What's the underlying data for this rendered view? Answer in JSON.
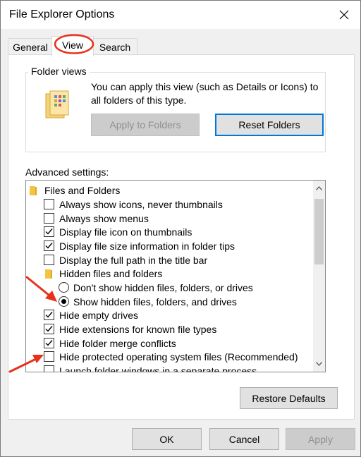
{
  "window": {
    "title": "File Explorer Options"
  },
  "tabs": [
    {
      "label": "General"
    },
    {
      "label": "View"
    },
    {
      "label": "Search"
    }
  ],
  "folder_views": {
    "group_label": "Folder views",
    "description": "You can apply this view (such as Details or Icons) to all folders of this type.",
    "apply_button": "Apply to Folders",
    "reset_button": "Reset Folders"
  },
  "advanced": {
    "label": "Advanced settings:",
    "items": [
      {
        "text": "Files and Folders",
        "kind": "folder"
      },
      {
        "text": "Always show icons, never thumbnails",
        "kind": "checkbox",
        "checked": false
      },
      {
        "text": "Always show menus",
        "kind": "checkbox",
        "checked": false
      },
      {
        "text": "Display file icon on thumbnails",
        "kind": "checkbox",
        "checked": true
      },
      {
        "text": "Display file size information in folder tips",
        "kind": "checkbox",
        "checked": true
      },
      {
        "text": "Display the full path in the title bar",
        "kind": "checkbox",
        "checked": false
      },
      {
        "text": "Hidden files and folders",
        "kind": "folder"
      },
      {
        "text": "Don't show hidden files, folders, or drives",
        "kind": "radio",
        "checked": false
      },
      {
        "text": "Show hidden files, folders, and drives",
        "kind": "radio",
        "checked": true
      },
      {
        "text": "Hide empty drives",
        "kind": "checkbox",
        "checked": true
      },
      {
        "text": "Hide extensions for known file types",
        "kind": "checkbox",
        "checked": true
      },
      {
        "text": "Hide folder merge conflicts",
        "kind": "checkbox",
        "checked": true
      },
      {
        "text": "Hide protected operating system files (Recommended)",
        "kind": "checkbox",
        "checked": false
      },
      {
        "text": "Launch folder windows in a separate process",
        "kind": "checkbox",
        "checked": false
      }
    ]
  },
  "restore_defaults": "Restore Defaults",
  "footer": {
    "ok": "OK",
    "cancel": "Cancel",
    "apply": "Apply"
  },
  "colors": {
    "accent": "#0078d7",
    "annotation": "#e8311a",
    "folder": "#f5c342"
  }
}
